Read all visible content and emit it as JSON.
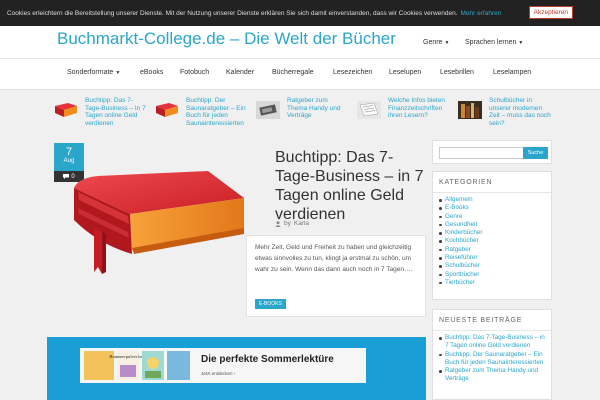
{
  "cookie": {
    "message": "Cookies erleichtern die Bereitstellung unserer Dienste. Mit der Nutzung unserer Dienste erklären Sie sich damit einverstanden, dass wir Cookies verwenden.",
    "more_label": "Mehr erfahren",
    "accept_label": "Akzeptieren"
  },
  "site": {
    "title": "Buchmarkt-College.de – Die Welt der Bücher"
  },
  "top_nav": [
    {
      "label": "Genre",
      "caret": "▼"
    },
    {
      "label": "Sprachen lernen",
      "caret": "▼"
    }
  ],
  "main_nav": [
    {
      "label": "Sonderformate",
      "caret": "▼"
    },
    {
      "label": "eBooks"
    },
    {
      "label": "Fotobuch"
    },
    {
      "label": "Kalender"
    },
    {
      "label": "Bücherregale"
    },
    {
      "label": "Lesezeichen"
    },
    {
      "label": "Leselupen"
    },
    {
      "label": "Lesebrillen"
    },
    {
      "label": "Leselampen"
    }
  ],
  "featured": [
    {
      "title": "Buchtipp: Das 7-Tage-Business – In 7 Tagen online Geld verdienen"
    },
    {
      "title": "Buchtipp: Der Saunaratgeber – Ein Buch für jeden Saunainteressierten"
    },
    {
      "title": "Ratgeber zum Thema Handy und Verträge"
    },
    {
      "title": "Welche Infos bieten Finanzzeitschriften ihren Lesern?"
    },
    {
      "title": "Schulbücher in unserer modernen Zeit – muss das noch sein?"
    }
  ],
  "post": {
    "day": "7",
    "month": "Aug",
    "comments": "0",
    "comment_icon": "speech-bubble-icon",
    "title": "Buchtipp: Das 7-Tage-Business – in 7 Tagen online Geld verdienen",
    "author_prefix": "by",
    "author": "Karla",
    "excerpt": "Mehr Zeit, Geld und Freiheit zu haben und gleichzeitig etwas sinnvolles zu tun, klingt ja erstmal zu schön, um wahr zu sein. Wenn das dann auch noch in 7 Tagen….",
    "tag": "E-BOOKS"
  },
  "promo": {
    "title": "Die perfekte Sommerlektüre",
    "link": "Jetzt entdecken ›",
    "book_text": "Brunnen-pulver hexe"
  },
  "search": {
    "placeholder": "",
    "button": "Suche"
  },
  "categories": {
    "title": "KATEGORIEN",
    "items": [
      "Allgemein",
      "E-Books",
      "Genre",
      "Gesundheit",
      "Kinderbücher",
      "Kochbücher",
      "Ratgeber",
      "Reiseführer",
      "Schulbücher",
      "Sportbücher",
      "Tierbücher"
    ]
  },
  "recent": {
    "title": "NEUESTE BEITRÄGE",
    "items": [
      "Buchtipp: Das 7-Tage-Business – in 7 Tagen online Geld verdienen",
      "Buchtipp: Der Saunaratgeber – Ein Buch für jeden Saunainteressierten",
      "Ratgeber zum Thema Handy und Verträge"
    ]
  },
  "colors": {
    "accent": "#2ba6cb",
    "promo_bg": "#1a9ed6",
    "book_red": "#d9262a",
    "book_orange": "#f08c1e"
  }
}
